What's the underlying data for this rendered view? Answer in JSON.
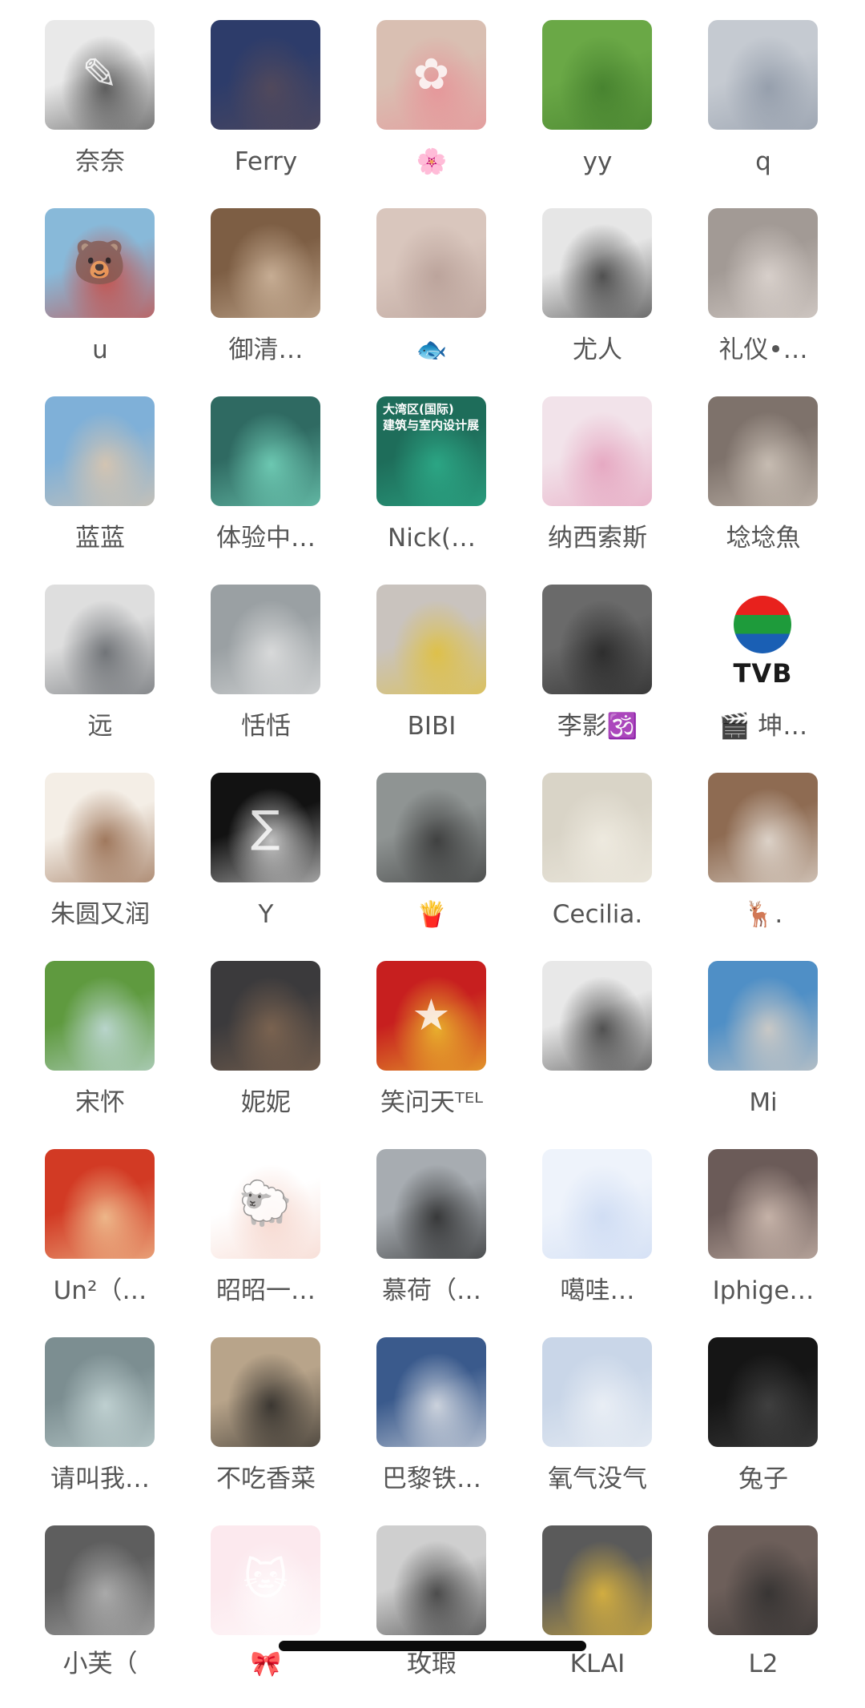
{
  "contacts": [
    {
      "name": "奈奈",
      "icon": "girl-sketch-portrait",
      "bg": "#e9e9e9",
      "fg": "#3a3a3a",
      "glyph": "✎"
    },
    {
      "name": "Ferry",
      "icon": "girl-portrait-blue",
      "bg": "#2d3c6a",
      "fg": "#5a4c58",
      "glyph": ""
    },
    {
      "name": "🌸",
      "icon": "girl-portrait-flower",
      "bg": "#d9bfb2",
      "fg": "#e98d94",
      "glyph": "✿"
    },
    {
      "name": "yy",
      "icon": "child-and-dog-on-grass",
      "bg": "#6aa846",
      "fg": "#3f7a2a",
      "glyph": ""
    },
    {
      "name": "q",
      "icon": "girl-portrait-hair",
      "bg": "#c5cad1",
      "fg": "#8a94a3",
      "glyph": ""
    },
    {
      "name": "u",
      "icon": "winnie-the-pooh-balloons",
      "bg": "#88b9d9",
      "fg": "#d33a2c",
      "glyph": "🐻"
    },
    {
      "name": "御清…",
      "icon": "girl-with-drink",
      "bg": "#7d5e44",
      "fg": "#d9c1a8",
      "glyph": ""
    },
    {
      "name": "🐟",
      "icon": "girl-lying-portrait",
      "bg": "#d9c6bd",
      "fg": "#b49b93",
      "glyph": ""
    },
    {
      "name": "尤人",
      "icon": "figure-dark-coat-with-flowers",
      "bg": "#e6e6e6",
      "fg": "#2a2a2a",
      "glyph": ""
    },
    {
      "name": "礼仪•…",
      "icon": "woman-in-dress",
      "bg": "#a29a95",
      "fg": "#e5ddd8",
      "glyph": ""
    },
    {
      "name": "蓝蓝",
      "icon": "girl-on-swing",
      "bg": "#7fb0d8",
      "fg": "#e8c9a8",
      "glyph": ""
    },
    {
      "name": "体验中…",
      "icon": "underwater-scene",
      "bg": "#2f6a62",
      "fg": "#7ce0c6",
      "glyph": ""
    },
    {
      "name": "Nick(…",
      "icon": "design-exhibition-poster",
      "bg": "#1e6d5a",
      "fg": "#2fb48f",
      "glyph": "",
      "poster": "大湾区(国际)\n建筑与室内设计展"
    },
    {
      "name": "纳西索斯",
      "icon": "boy-with-pink-flowers",
      "bg": "#f2e3ea",
      "fg": "#e39ab8",
      "glyph": ""
    },
    {
      "name": "埝埝魚",
      "icon": "baby-photo-vintage",
      "bg": "#7e726b",
      "fg": "#d9cfc4",
      "glyph": ""
    },
    {
      "name": "远",
      "icon": "person-with-grey-cat",
      "bg": "#dedede",
      "fg": "#55595e",
      "glyph": ""
    },
    {
      "name": "恬恬",
      "icon": "girl-white-sweater",
      "bg": "#9aa0a3",
      "fg": "#e8e8e8",
      "glyph": ""
    },
    {
      "name": "BIBI",
      "icon": "girl-with-yellow-bag",
      "bg": "#c9c3be",
      "fg": "#e3c02c",
      "glyph": ""
    },
    {
      "name": "李影🕉️",
      "icon": "monochrome-portrait",
      "bg": "#6a6a6a",
      "fg": "#1e1e1e",
      "glyph": ""
    },
    {
      "name": "🎬 坤…",
      "icon": "tvb-logo",
      "bg": "#ffffff",
      "fg": "#1a1a1a",
      "glyph": "",
      "logo": "TVB"
    },
    {
      "name": "朱圆又润",
      "icon": "cartoon-boy-sketch",
      "bg": "#f4eee6",
      "fg": "#8a5a3a",
      "glyph": ""
    },
    {
      "name": "Y",
      "icon": "math-formulas-blackboard",
      "bg": "#121212",
      "fg": "#f0f0f0",
      "glyph": "∑"
    },
    {
      "name": "🍟",
      "icon": "woman-walking-street",
      "bg": "#8f9493",
      "fg": "#2b2b2b",
      "glyph": ""
    },
    {
      "name": "Cecilia.",
      "icon": "woman-in-office",
      "bg": "#d9d4c7",
      "fg": "#f3efe5",
      "glyph": ""
    },
    {
      "name": "🦌.",
      "icon": "girl-with-camera",
      "bg": "#8e6b52",
      "fg": "#f0ece6",
      "glyph": ""
    },
    {
      "name": "宋怀",
      "icon": "man-on-green-hill",
      "bg": "#5f9a3f",
      "fg": "#cfe3ef",
      "glyph": ""
    },
    {
      "name": "妮妮",
      "icon": "girl-with-sunglasses-and-dog",
      "bg": "#3b3a3c",
      "fg": "#8a6d55",
      "glyph": ""
    },
    {
      "name": "笑问天ᵀᴱᴸ",
      "icon": "man-with-flag",
      "bg": "#c71f1f",
      "fg": "#f1d330",
      "glyph": "★"
    },
    {
      "name": "",
      "icon": "man-profile-silhouette",
      "bg": "#e8e8e8",
      "fg": "#2a2a2a",
      "glyph": ""
    },
    {
      "name": "Mi",
      "icon": "girl-at-beach",
      "bg": "#4f8fc6",
      "fg": "#e8d7c6",
      "glyph": ""
    },
    {
      "name": "Un²（…",
      "icon": "anime-red-character",
      "bg": "#d23a24",
      "fg": "#f4d6a3",
      "glyph": ""
    },
    {
      "name": "昭昭一…",
      "icon": "cartoon-sheep",
      "bg": "#ffffff",
      "fg": "#f4cfc4",
      "glyph": "🐑"
    },
    {
      "name": "慕荷（…",
      "icon": "woman-with-headphones",
      "bg": "#a7acb1",
      "fg": "#1b1b1b",
      "glyph": ""
    },
    {
      "name": "噶哇…",
      "icon": "glowing-white-creature",
      "bg": "#eef3fb",
      "fg": "#c9d8f2",
      "glyph": ""
    },
    {
      "name": "Iphige…",
      "icon": "woman-with-beanie",
      "bg": "#6b5b58",
      "fg": "#dcc8bc",
      "glyph": ""
    },
    {
      "name": "请叫我…",
      "icon": "person-at-mixing-desk",
      "bg": "#7c8e91",
      "fg": "#cfe0e0",
      "glyph": ""
    },
    {
      "name": "不吃香菜",
      "icon": "black-white-kitten",
      "bg": "#b8a48a",
      "fg": "#1b1b1b",
      "glyph": ""
    },
    {
      "name": "巴黎铁…",
      "icon": "woman-in-white-shirt",
      "bg": "#3a5a8c",
      "fg": "#f1f1f1",
      "glyph": ""
    },
    {
      "name": "氧气没气",
      "icon": "bedroom-blue-blanket",
      "bg": "#c9d6e8",
      "fg": "#f1f4f8",
      "glyph": ""
    },
    {
      "name": "兔子",
      "icon": "woman-in-black-dress",
      "bg": "#151515",
      "fg": "#4a4a4a",
      "glyph": ""
    },
    {
      "name": "小芙（",
      "icon": "monochrome-person-lying",
      "bg": "#5e5e5e",
      "fg": "#bdbdbd",
      "glyph": ""
    },
    {
      "name": "🎀",
      "icon": "hello-kitty",
      "bg": "#fce9ee",
      "fg": "#ffffff",
      "glyph": "🐱"
    },
    {
      "name": "玫瑕",
      "icon": "monochrome-woman-face",
      "bg": "#cfcfcf",
      "fg": "#2a2a2a",
      "glyph": ""
    },
    {
      "name": "KLAI",
      "icon": "cartoon-bunny-girl",
      "bg": "#5a5a5a",
      "fg": "#f0c23a",
      "glyph": ""
    },
    {
      "name": "L2",
      "icon": "two-women-dark",
      "bg": "#6d5f5a",
      "fg": "#2a2a2a",
      "glyph": ""
    }
  ]
}
